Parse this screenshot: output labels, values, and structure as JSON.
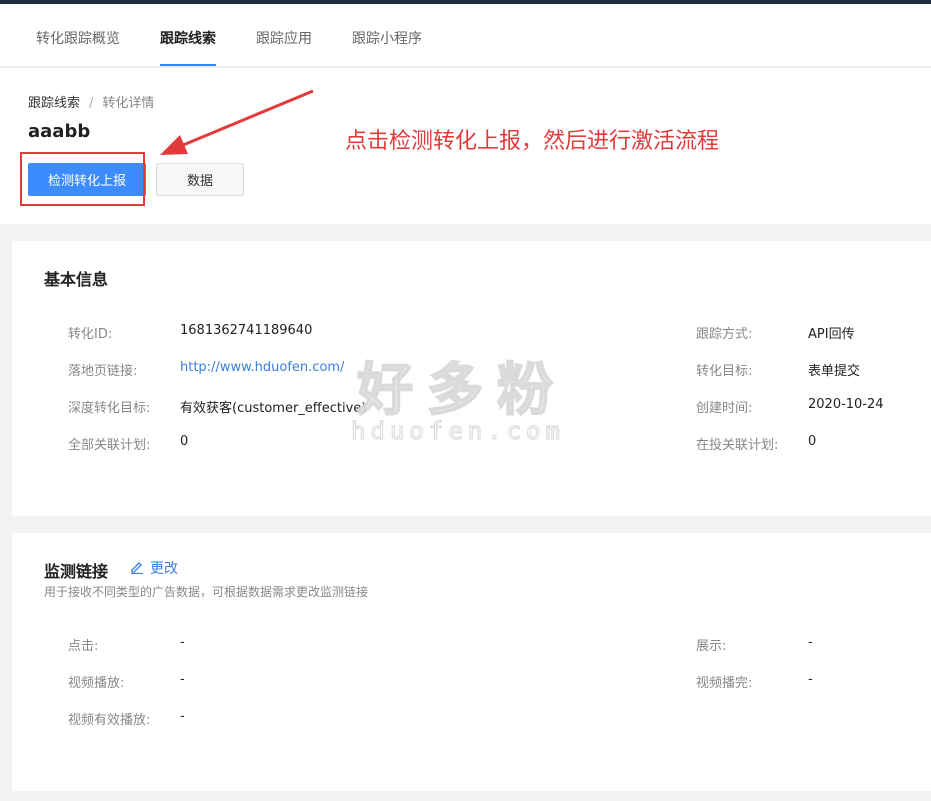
{
  "tabs": [
    {
      "label": "转化跟踪概览",
      "active": false
    },
    {
      "label": "跟踪线索",
      "active": true
    },
    {
      "label": "跟踪应用",
      "active": false
    },
    {
      "label": "跟踪小程序",
      "active": false
    }
  ],
  "breadcrumb": {
    "parent": "跟踪线索",
    "separator": "/",
    "current": "转化详情"
  },
  "page_title": "aaabb",
  "buttons": {
    "detect": "检测转化上报",
    "data": "数据"
  },
  "annotation": {
    "text": "点击检测转化上报，然后进行激活流程",
    "color": "#e23b3b"
  },
  "basic_info": {
    "title": "基本信息",
    "left": [
      {
        "label": "转化ID:",
        "value": "1681362741189640"
      },
      {
        "label": "落地页链接:",
        "value": "http://www.hduofen.com/"
      },
      {
        "label": "深度转化目标:",
        "value": "有效获客(customer_effective)"
      },
      {
        "label": "全部关联计划:",
        "value": "0"
      }
    ],
    "right": [
      {
        "label": "跟踪方式:",
        "value": "API回传"
      },
      {
        "label": "转化目标:",
        "value": "表单提交"
      },
      {
        "label": "创建时间:",
        "value": "2020-10-24"
      },
      {
        "label": "在投关联计划:",
        "value": "0"
      }
    ]
  },
  "monitor": {
    "title": "监测链接",
    "edit": "更改",
    "subtitle": "用于接收不同类型的广告数据，可根据数据需求更改监测链接",
    "left": [
      {
        "label": "点击:",
        "value": "-"
      },
      {
        "label": "视频播放:",
        "value": "-"
      },
      {
        "label": "视频有效播放:",
        "value": "-"
      }
    ],
    "right": [
      {
        "label": "展示:",
        "value": "-"
      },
      {
        "label": "视频播完:",
        "value": "-"
      }
    ]
  },
  "watermark": {
    "cn": "好多粉",
    "en": "hduofen.com"
  },
  "colors": {
    "primary": "#3c8cff",
    "link": "#3c7fd9",
    "annotation": "#e23b3b"
  }
}
